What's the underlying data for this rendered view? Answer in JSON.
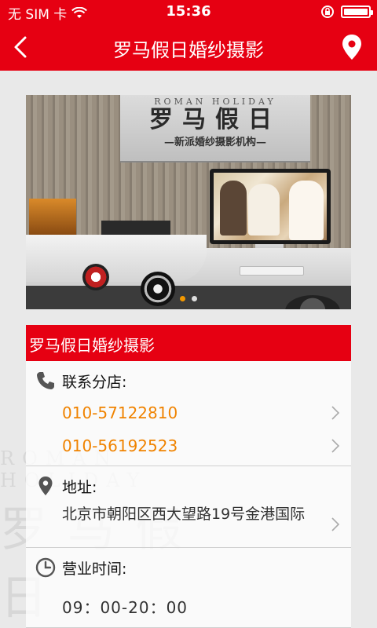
{
  "status_bar": {
    "carrier": "无 SIM 卡",
    "time": "15:36",
    "battery_level": 1.0
  },
  "nav": {
    "title": "罗马假日婚纱摄影",
    "back_icon": "back-chevron-icon",
    "location_icon": "location-pin-icon"
  },
  "banner": {
    "sign_en": "ROMAN HOLIDAY",
    "sign_cn": "罗马假日",
    "sign_sub": "—新派婚纱摄影机构—",
    "slide_count": 2,
    "active_slide": 1
  },
  "store": {
    "header": "罗马假日婚纱摄影",
    "contact": {
      "label": "联系分店:",
      "phones": [
        "010-57122810",
        "010-56192523"
      ]
    },
    "address": {
      "label": "地址:",
      "text": "北京市朝阳区西大望路19号金港国际"
    },
    "hours": {
      "label": "营业时间:",
      "text": "09：00-20：00"
    }
  },
  "colors": {
    "brand_red": "#e60012",
    "phone_orange": "#f08300",
    "dot_active": "#f39800"
  }
}
